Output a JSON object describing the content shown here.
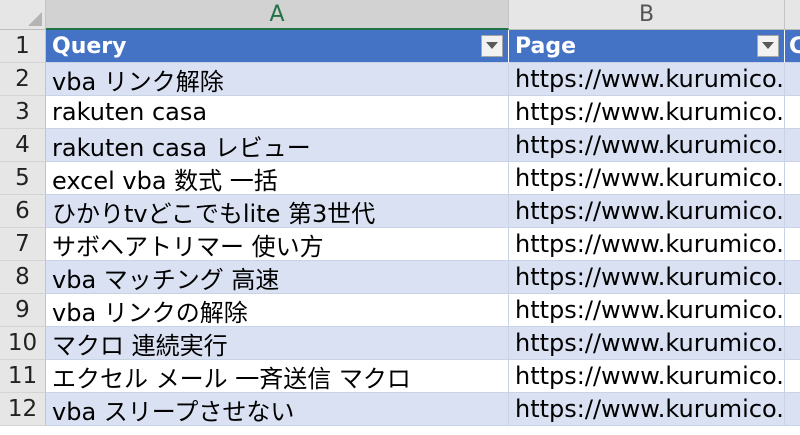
{
  "columns": [
    "A",
    "B"
  ],
  "header": {
    "query": "Query",
    "page": "Page",
    "next": "C"
  },
  "rows": [
    {
      "num": "1"
    },
    {
      "num": "2",
      "query": "vba リンク解除",
      "page": "https://www.kurumico.c"
    },
    {
      "num": "3",
      "query": "rakuten casa",
      "page": "https://www.kurumico.c"
    },
    {
      "num": "4",
      "query": "rakuten casa レビュー",
      "page": "https://www.kurumico.c"
    },
    {
      "num": "5",
      "query": "excel vba 数式 一括",
      "page": "https://www.kurumico.c"
    },
    {
      "num": "6",
      "query": "ひかりtvどこでもlite 第3世代",
      "page": "https://www.kurumico.c"
    },
    {
      "num": "7",
      "query": "サボヘアトリマー 使い方",
      "page": "https://www.kurumico.c"
    },
    {
      "num": "8",
      "query": "vba マッチング 高速",
      "page": "https://www.kurumico.c"
    },
    {
      "num": "9",
      "query": "vba リンクの解除",
      "page": "https://www.kurumico.c"
    },
    {
      "num": "10",
      "query": "マクロ 連続実行",
      "page": "https://www.kurumico.c"
    },
    {
      "num": "11",
      "query": "エクセル メール 一斉送信 マクロ",
      "page": "https://www.kurumico.c"
    },
    {
      "num": "12",
      "query": "vba スリープさせない",
      "page": "https://www.kurumico.c"
    }
  ],
  "colors": {
    "header_fill": "#4472c4",
    "band_fill": "#d9e1f2",
    "selected_col": "#217346"
  }
}
